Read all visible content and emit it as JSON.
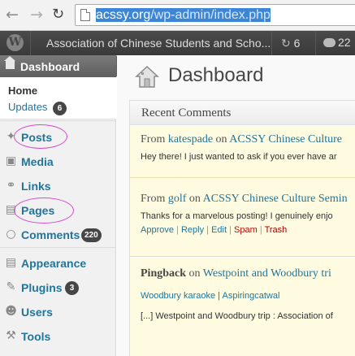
{
  "browser": {
    "back_icon": "back-arrow-icon",
    "forward_icon": "forward-arrow-icon",
    "reload_icon": "reload-icon",
    "url_domain": "acssy.org",
    "url_path": "/wp-admin/index.php"
  },
  "admin_bar": {
    "logo": "W",
    "site_name": "Association of Chinese Students and Scho...",
    "updates_count": "6",
    "comments_count": "22"
  },
  "sidebar": {
    "dashboard": "Dashboard",
    "home": "Home",
    "updates": "Updates",
    "updates_count": "6",
    "items": [
      {
        "label": "Posts",
        "icon": "pushpin-icon"
      },
      {
        "label": "Media",
        "icon": "media-icon"
      },
      {
        "label": "Links",
        "icon": "links-icon"
      },
      {
        "label": "Pages",
        "icon": "pages-icon"
      },
      {
        "label": "Comments",
        "icon": "comments-icon",
        "count": "220"
      },
      {
        "label": "Appearance",
        "icon": "appearance-icon"
      },
      {
        "label": "Plugins",
        "icon": "plugins-icon",
        "count": "3"
      },
      {
        "label": "Users",
        "icon": "users-icon"
      },
      {
        "label": "Tools",
        "icon": "tools-icon"
      }
    ],
    "highlight_color": "#d64cd0"
  },
  "main": {
    "title": "Dashboard",
    "recent_comments": {
      "title": "Recent Comments",
      "comments": [
        {
          "from": "From",
          "author": "katespade",
          "on": "on",
          "post": "ACSSY Chinese Culture",
          "text": "Hey there! I just wanted to ask if you ever have ar"
        },
        {
          "from": "From",
          "author": "golf",
          "on": "on",
          "post": "ACSSY Chinese Culture Semin",
          "text": "Thanks for a marvelous posting! I genuinely enjo",
          "actions": {
            "approve": "Approve",
            "reply": "Reply",
            "edit": "Edit",
            "spam": "Spam",
            "trash": "Trash",
            "sep": "|"
          }
        },
        {
          "type": "Pingback",
          "on": "on",
          "post": "Westpoint and Woodbury tri",
          "link": "Woodbury karaoke | Aspiringcatwal",
          "text": "[...] Westpoint and Woodbury trip : Association of"
        }
      ]
    }
  }
}
